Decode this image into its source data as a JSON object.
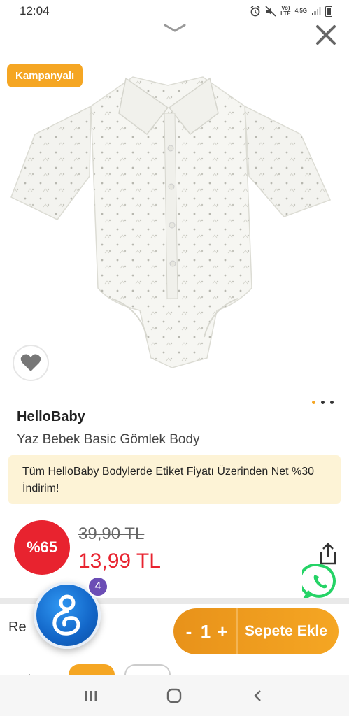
{
  "status_bar": {
    "time": "12:04",
    "network_label_top": "Vo)",
    "network_label_bottom": "LTE",
    "network_type": "4.5G",
    "icons": [
      "alarm-icon",
      "mute-icon",
      "signal-icon",
      "battery-icon"
    ]
  },
  "header": {
    "collapse_icon": "chevron-down-icon",
    "close_icon": "close-icon"
  },
  "product": {
    "campaign_badge": "Kampanyalı",
    "brand": "HelloBaby",
    "name": "Yaz Bebek Basic Gömlek Body",
    "image_pager_total": 3,
    "image_pager_active": 1,
    "promo_text": "Tüm HelloBaby Bodylerde Etiket Fiyatı Üzerinden Net %30 İndirim!",
    "discount_badge": "%65",
    "old_price": "39,90 TL",
    "new_price": "13,99 TL"
  },
  "cart": {
    "row_label": "Re",
    "qty_minus": "-",
    "qty_value": "1",
    "qty_plus": "+",
    "add_button": "Sepete Ekle"
  },
  "assistant": {
    "badge_count": "4"
  },
  "next_row": {
    "label": "Beden"
  },
  "colors": {
    "accent_orange": "#f5a623",
    "price_red": "#e8232f",
    "promo_bg": "#fdf3d6",
    "whatsapp_green": "#25d366"
  }
}
